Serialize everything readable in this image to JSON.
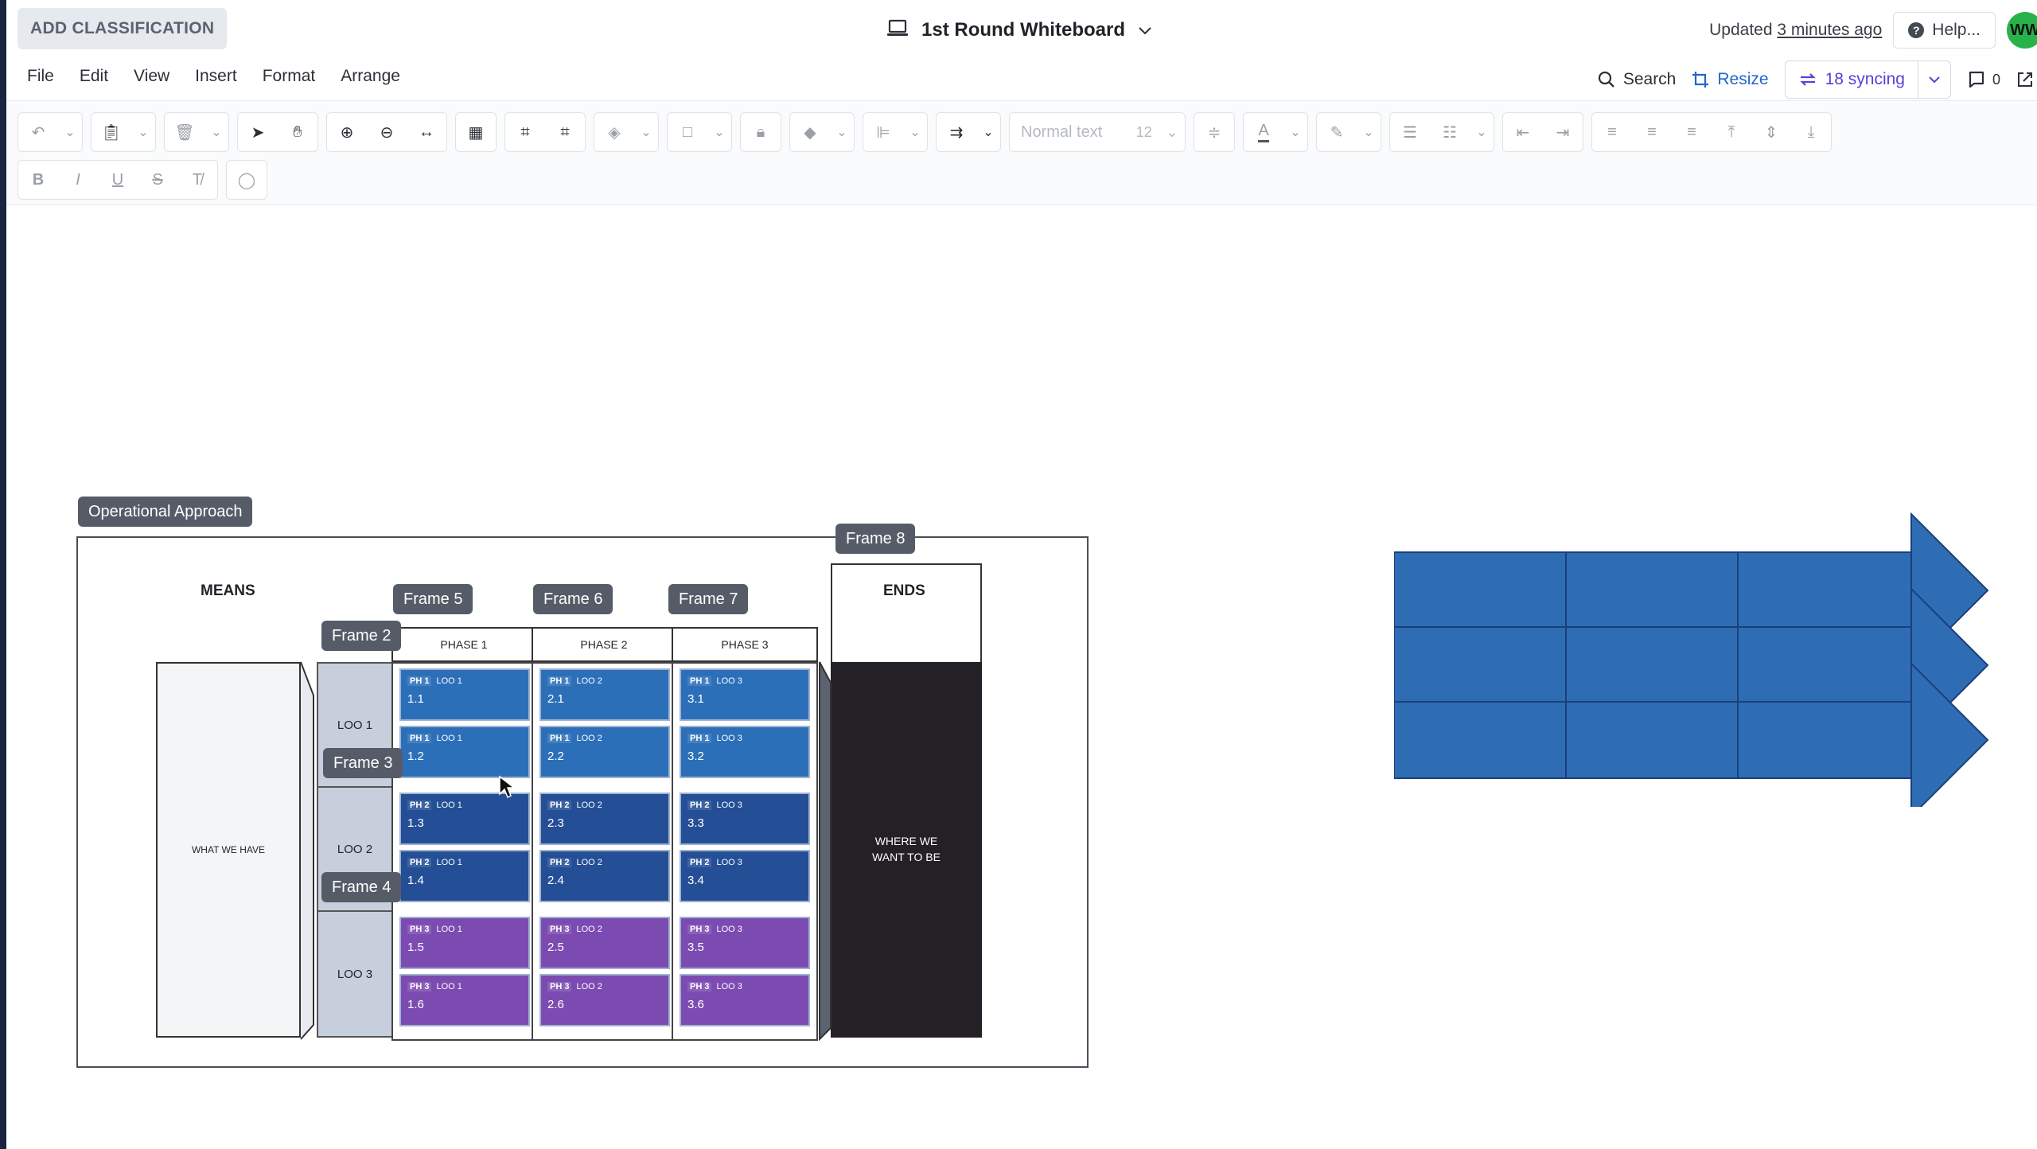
{
  "header": {
    "classification_label": "ADD CLASSIFICATION",
    "doc_title": "1st Round Whiteboard",
    "updated_prefix": "Updated",
    "updated_time": "3 minutes ago",
    "help_label": "Help...",
    "avatar_initials": "WW"
  },
  "menu": {
    "items": [
      "File",
      "Edit",
      "View",
      "Insert",
      "Format",
      "Arrange"
    ],
    "search_label": "Search",
    "resize_label": "Resize",
    "syncing_label": "18 syncing",
    "comment_count": "0"
  },
  "toolbar": {
    "font_name": "Normal text",
    "font_size": "12"
  },
  "canvas": {
    "operational_approach_label": "Operational Approach",
    "means_label": "MEANS",
    "ends_label": "ENDS",
    "what_we_have": "WHAT WE HAVE",
    "where_we_want_line1": "WHERE WE",
    "where_we_want_line2": "WANT TO BE",
    "frames": {
      "f2": "Frame 2",
      "f3": "Frame 3",
      "f4": "Frame 4",
      "f5": "Frame 5",
      "f6": "Frame 6",
      "f7": "Frame 7",
      "f8": "Frame 8"
    },
    "phases": [
      "PHASE 1",
      "PHASE 2",
      "PHASE 3"
    ],
    "loos": [
      "LOO 1",
      "LOO 2",
      "LOO 3"
    ],
    "cells": [
      [
        {
          "ph": "PH 1",
          "loo": "LOO 1",
          "num": "1.1"
        },
        {
          "ph": "PH 1",
          "loo": "LOO 1",
          "num": "1.2"
        },
        {
          "ph": "PH 2",
          "loo": "LOO 1",
          "num": "1.3"
        },
        {
          "ph": "PH 2",
          "loo": "LOO 1",
          "num": "1.4"
        },
        {
          "ph": "PH 3",
          "loo": "LOO 1",
          "num": "1.5"
        },
        {
          "ph": "PH 3",
          "loo": "LOO 1",
          "num": "1.6"
        }
      ],
      [
        {
          "ph": "PH 1",
          "loo": "LOO 2",
          "num": "2.1"
        },
        {
          "ph": "PH 1",
          "loo": "LOO 2",
          "num": "2.2"
        },
        {
          "ph": "PH 2",
          "loo": "LOO 2",
          "num": "2.3"
        },
        {
          "ph": "PH 2",
          "loo": "LOO 2",
          "num": "2.4"
        },
        {
          "ph": "PH 3",
          "loo": "LOO 2",
          "num": "2.5"
        },
        {
          "ph": "PH 3",
          "loo": "LOO 2",
          "num": "2.6"
        }
      ],
      [
        {
          "ph": "PH 1",
          "loo": "LOO 3",
          "num": "3.1"
        },
        {
          "ph": "PH 1",
          "loo": "LOO 3",
          "num": "3.2"
        },
        {
          "ph": "PH 2",
          "loo": "LOO 3",
          "num": "3.3"
        },
        {
          "ph": "PH 2",
          "loo": "LOO 3",
          "num": "3.4"
        },
        {
          "ph": "PH 3",
          "loo": "LOO 3",
          "num": "3.5"
        },
        {
          "ph": "PH 3",
          "loo": "LOO 3",
          "num": "3.6"
        }
      ]
    ]
  },
  "colors": {
    "arrow_blue": "#2e6db4",
    "ph1": "#2c6fb9",
    "ph2": "#244f96",
    "ph3": "#7c4bb1",
    "sync_purple": "#5a3fd8",
    "resize_blue": "#2266cc"
  }
}
